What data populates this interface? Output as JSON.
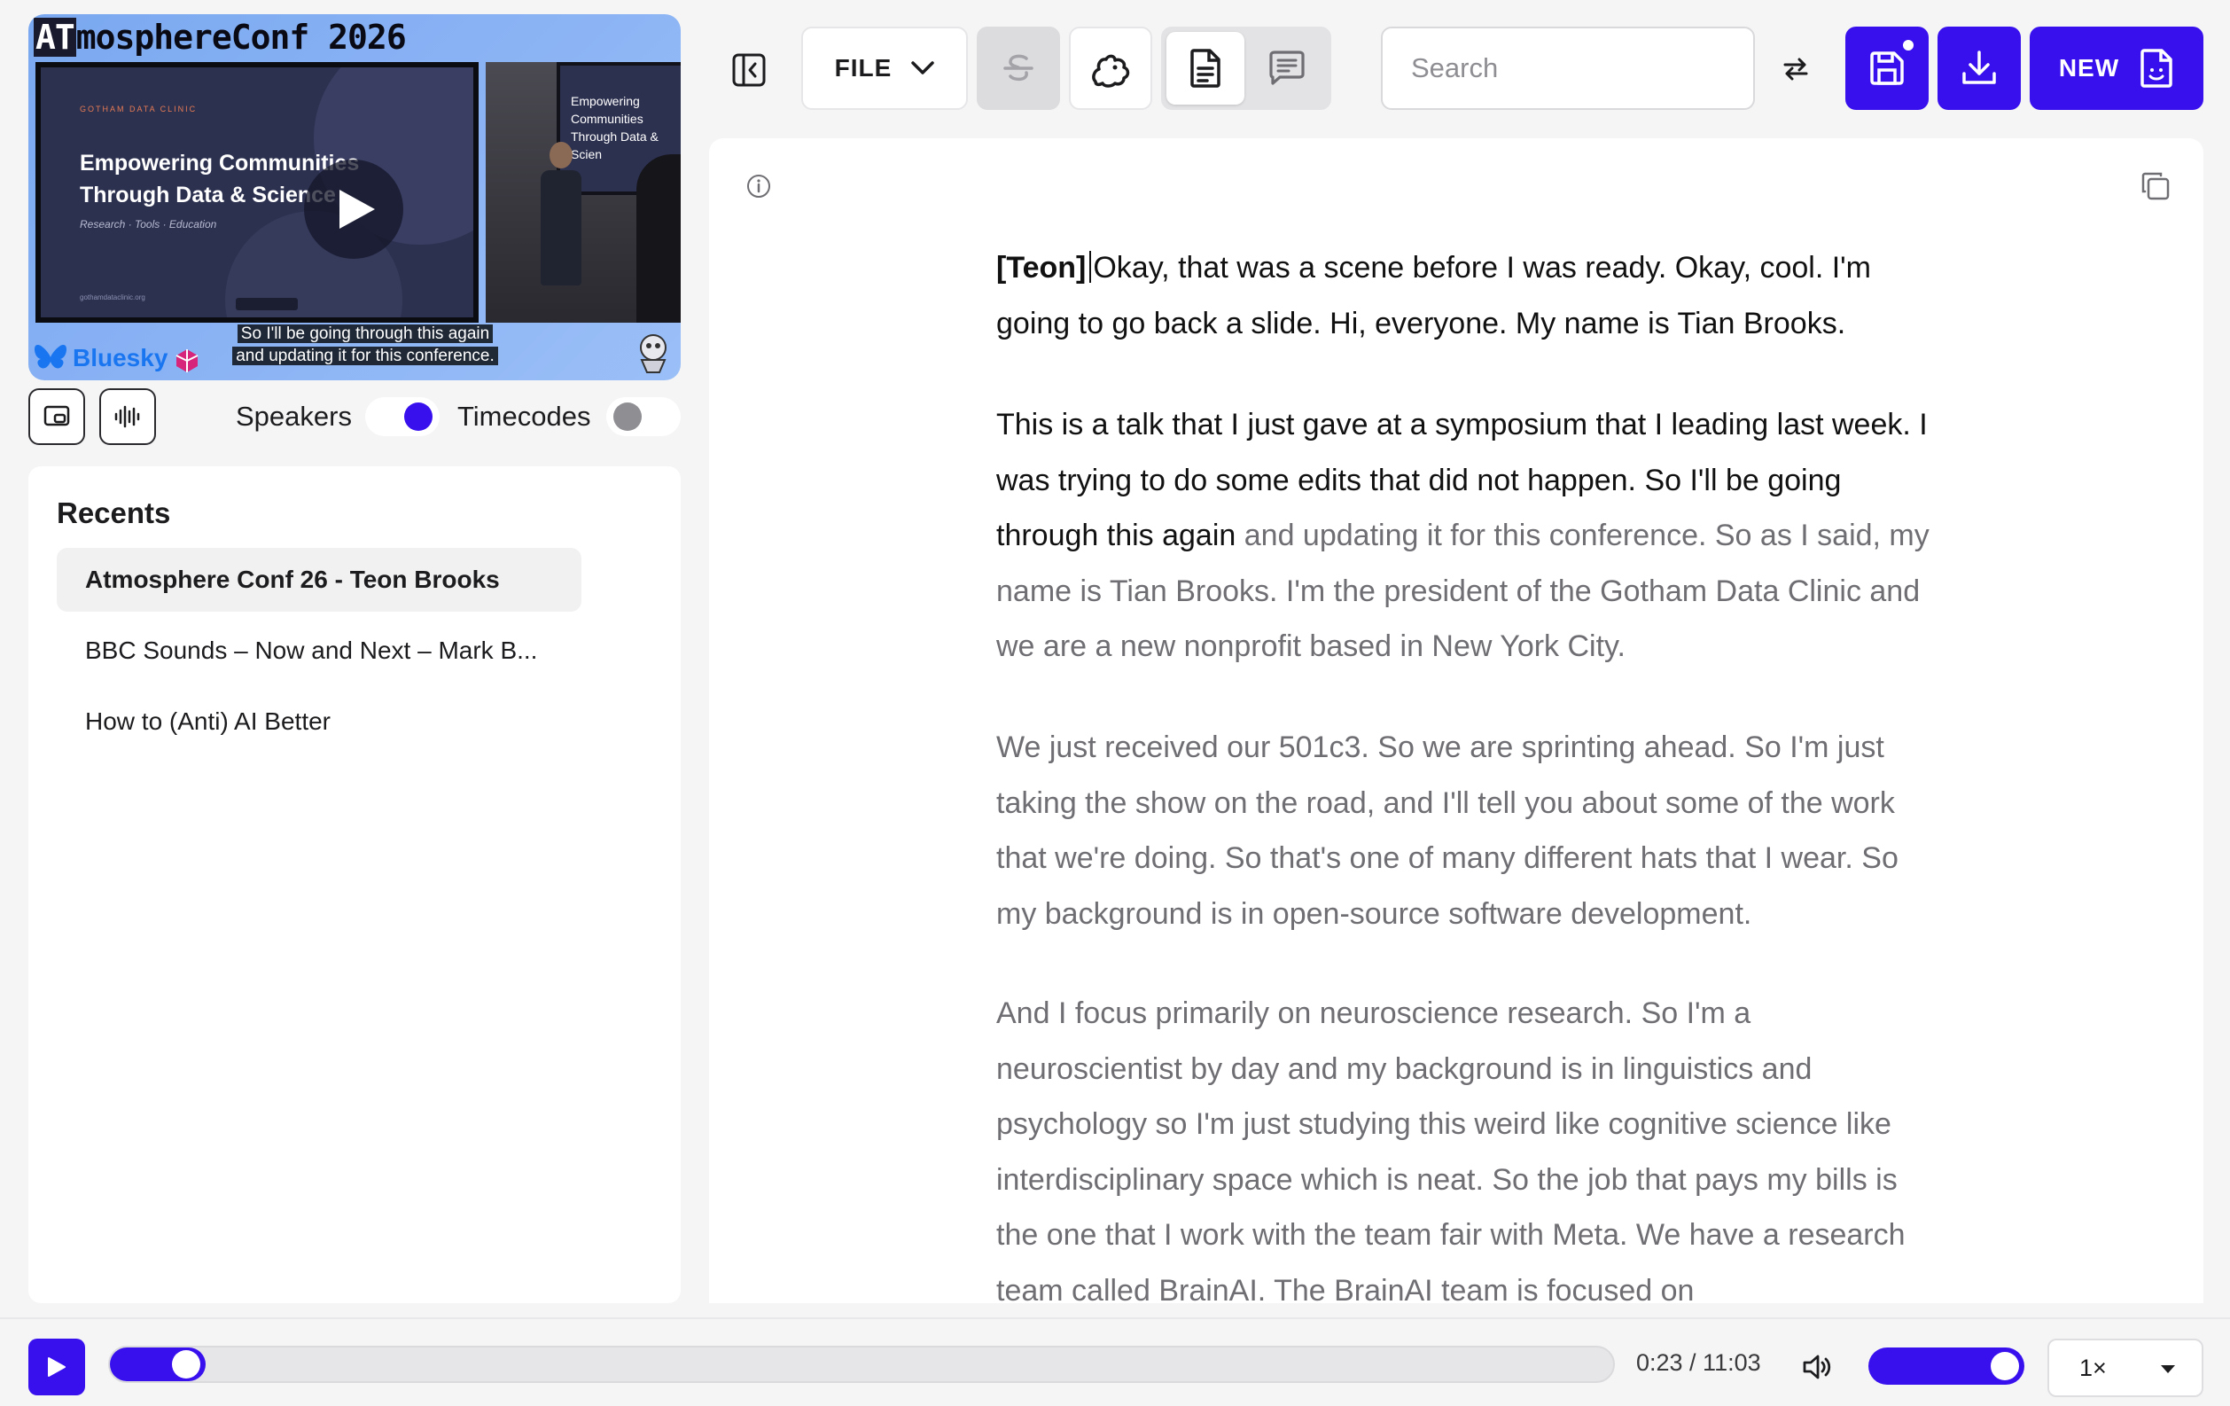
{
  "video": {
    "conf_title_hl": "AT",
    "conf_title_rest": "mosphereConf 2026",
    "slide_org": "GOTHAM DATA CLINIC",
    "slide_title": "Empowering Communities Through Data & Science",
    "slide_subtitle": "Research · Tools · Education",
    "slide_url": "gothamdataclinic.org",
    "side_screen_text": "Empowering Communities Through Data & Scien",
    "caption_line1": "So I'll be going through this again",
    "caption_line2": "and updating it for this conference.",
    "sponsor": "Bluesky"
  },
  "toggles": {
    "speakers_label": "Speakers",
    "speakers_on": true,
    "timecodes_label": "Timecodes",
    "timecodes_on": false
  },
  "recents": {
    "heading": "Recents",
    "items": [
      {
        "label": "Atmosphere Conf 26 - Teon Brooks",
        "active": true
      },
      {
        "label": "BBC Sounds – Now and Next – Mark B...",
        "active": false
      },
      {
        "label": "How to (Anti) AI Better",
        "active": false
      }
    ]
  },
  "toolbar": {
    "file_label": "FILE",
    "search_placeholder": "Search",
    "new_label": "NEW"
  },
  "transcript": {
    "speaker": "[Teon]",
    "paragraphs": [
      {
        "spoken": "Okay, that was a scene before I was ready. Okay, cool. I'm going to go back a slide. Hi, everyone. My name is Tian Brooks.",
        "rest": ""
      },
      {
        "spoken": "This is a talk that I just gave at a symposium that I leading last week. I was trying to do some edits that did not happen. So I'll be going through this again",
        "rest": " and updating it for this conference. So as I said, my name is Tian Brooks. I'm the president of the Gotham Data Clinic and we are a new nonprofit based in New York City."
      },
      {
        "spoken": "",
        "rest": "We just received our 501c3. So we are sprinting ahead. So I'm just taking the show on the road, and I'll tell you about some of the work that we're doing. So that's one of many different hats that I wear. So my background is in open-source software development."
      },
      {
        "spoken": "",
        "rest": "And I focus primarily on neuroscience research. So I'm a neuroscientist by day and my background is in linguistics and psychology so I'm just studying this weird like cognitive science like interdisciplinary space which is neat. So the job that pays my bills is the one that I work with the team fair with Meta. We have a research team called BrainAI. The BrainAI team is focused on"
      }
    ]
  },
  "player": {
    "time": "0:23 / 11:03",
    "progress_fraction": 0.035,
    "volume_fraction": 1.0,
    "speed": "1×"
  },
  "colors": {
    "accent": "#3810ee",
    "spoken_text": "#111111",
    "unspoken_text": "#6e6e73"
  },
  "icons": [
    "play-icon",
    "picture-in-picture-icon",
    "waveform-icon",
    "collapse-sidebar-icon",
    "chevron-down-icon",
    "strikethrough-icon",
    "squirrel-icon",
    "document-icon",
    "chat-icon",
    "swap-icon",
    "save-icon",
    "download-icon",
    "new-document-icon",
    "info-icon",
    "copy-icon",
    "volume-icon"
  ]
}
